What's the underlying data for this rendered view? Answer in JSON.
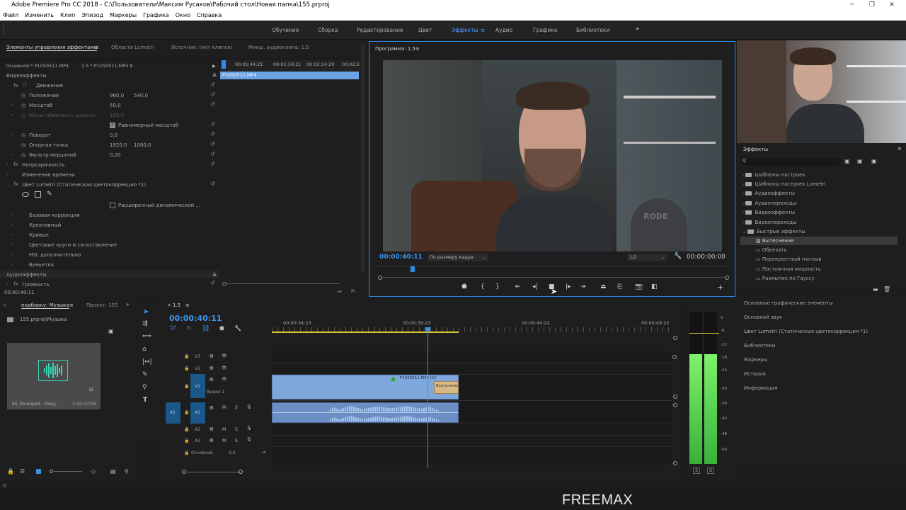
{
  "app": {
    "title": "Adobe Premiere Pro CC 2018 - C:\\Пользователи\\Максим Русаков\\Рабочий стол\\Новая папка\\155.prproj",
    "watermark": "FREEMAX"
  },
  "menu": [
    "Файл",
    "Изменить",
    "Клип",
    "Эпизод",
    "Маркеры",
    "Графика",
    "Окно",
    "Справка"
  ],
  "workspaces": [
    "Обучение",
    "Сборка",
    "Редактирование",
    "Цвет",
    "Эффекты",
    "Аудио",
    "Графика",
    "Библиотеки"
  ],
  "workspace_more": "»",
  "ec": {
    "tabs": [
      "Элементы управления эффектами",
      "Области Lumetri",
      "Источник: (нет клипов)",
      "Микш. аудиоклипа: 1.5"
    ],
    "master_clip": "Основной * P1050511.MP4",
    "seq_clip": "1.5 * P1050511.MP4",
    "ruler": [
      "00:01:44:21",
      "00:01:59:21",
      "00:02:14:20",
      "00:02:2"
    ],
    "clip_bar": "P1050511.MP4",
    "video_effects": "Видеоэффекты",
    "motion": "Движение",
    "position": "Положение",
    "position_x": "960,0",
    "position_y": "540,0",
    "scale": "Масштаб",
    "scale_v": "50,0",
    "scale_width": "Масштабировать ширину",
    "scale_width_v": "100,0",
    "uniform": "Равномерный масштаб",
    "rotation": "Поворот",
    "rotation_v": "0,0",
    "anchor": "Опорная точка",
    "anchor_x": "1920,0",
    "anchor_y": "1080,0",
    "flicker": "Фильтр мерцаний",
    "flicker_v": "0,00",
    "opacity": "Непрозрачность",
    "time_remap": "Изменение времени",
    "lumetri": "Цвет Lumetri (Статическая цветокоррекция *1)",
    "hdr": "Расширенный динамический ...",
    "basic": "Базовая коррекция",
    "creative": "Креативный",
    "curves": "Кривые",
    "wheels": "Цветовые круги и сопоставление",
    "hsl": "HSL дополнительно",
    "vignette": "Виньетка",
    "audio_effects": "Аудиоэффекты",
    "volume": "Громкость",
    "timecode": "00:00:40:11"
  },
  "program": {
    "tab": "Программа: 1.5",
    "timecode": "00:00:40:11",
    "fit": "По размеру кадра",
    "quality": "1/2",
    "duration": "00:00:00:00",
    "frame_text": "RODE"
  },
  "effects": {
    "title": "Эффекты",
    "items": [
      "Шаблоны настроек",
      "Шаблоны настроек Lumetri",
      "Аудиоэффекты",
      "Аудиопереходы",
      "Видеоэффекты",
      "Видеопереходы",
      "Быстрые эффекты"
    ],
    "subitems": [
      "Вытеснение",
      "Обрезать",
      "Перекрестный наплыв",
      "Постоянная мощность",
      "Размытие по Гауссу"
    ]
  },
  "right_panels": [
    "Основные графические элементы",
    "Основной звук",
    "Цвет Lumetri (Статическая цветокоррекция *1)",
    "Библиотеки",
    "Маркеры",
    "История",
    "Информация"
  ],
  "project": {
    "tabs": [
      "подборку: Музыка",
      "Проект: 155"
    ],
    "more": "»",
    "path": "155.prproj\\Музыка",
    "item_name": "ES_Divergent - Ooyy...",
    "item_duration": "3:18:42056"
  },
  "timeline": {
    "tab": "1.5",
    "timecode": "00:00:40:11",
    "ruler": [
      "00:00:34:23",
      "00:00:39:23",
      "00:00:44:22",
      "00:00:49:22"
    ],
    "tracks": {
      "v3": "V3",
      "v2": "V2",
      "v1": "V1",
      "v1_name": "Видео 1",
      "a1": "A1",
      "a2": "A2",
      "a3": "A3",
      "master": "Основной",
      "master_val": "0,0",
      "src_v": "V1",
      "src_a": "A1"
    },
    "clip_label": "P1050511.MP4 [V]",
    "transition": "Вытеснени",
    "m": "M",
    "s": "S"
  },
  "meter": {
    "scale": [
      "0",
      "-6",
      "-12",
      "-18",
      "-24",
      "-30",
      "-36",
      "-42",
      "-48",
      "-54"
    ],
    "solo_l": "S",
    "solo_r": "S"
  },
  "colors": {
    "accent": "#2d8ceb",
    "clip_video": "#7ea8dc",
    "clip_audio": "#6b8fc5",
    "meter": "#5ed648",
    "playhead": "#3d8fe0"
  }
}
